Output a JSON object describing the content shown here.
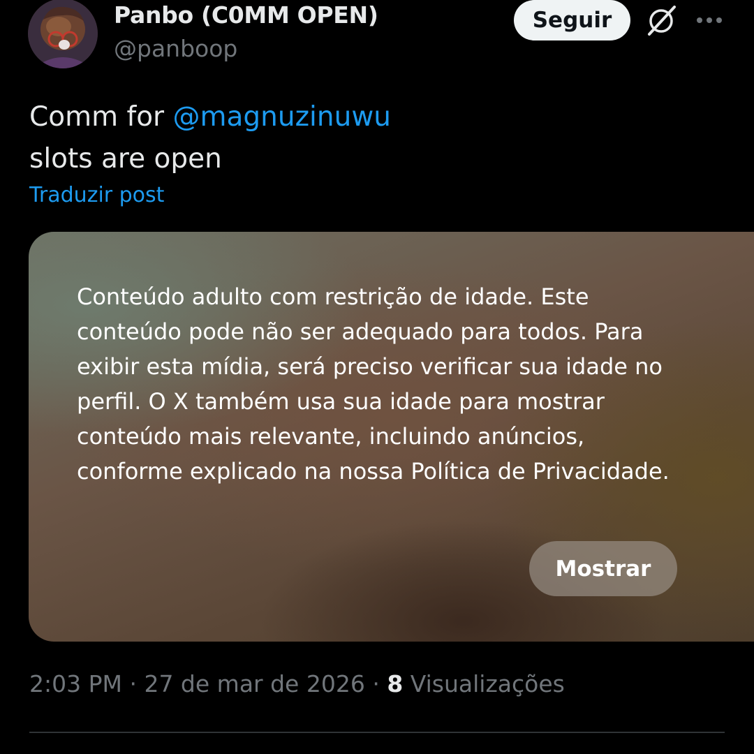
{
  "author": {
    "display_name": "Panbo (C0MM OPEN)",
    "handle": "@panboop"
  },
  "header": {
    "follow_label": "Seguir",
    "grok_icon": "grok-icon",
    "more_icon": "more-horizontal-icon"
  },
  "post": {
    "text_prefix": "Comm for ",
    "mention": "@magnuzinuwu",
    "text_line2": "slots are open",
    "translate_label": "Traduzir post"
  },
  "media": {
    "warning": "Conteúdo adulto com restrição de idade. Este conteúdo pode não ser adequado para todos. Para exibir esta mídia, será preciso verificar sua idade no perfil. O X também usa sua idade para mostrar conteúdo mais relevante, incluindo anúncios, conforme explicado na nossa Política de Privacidade.",
    "show_label": "Mostrar"
  },
  "meta": {
    "time": "2:03 PM",
    "separator": " · ",
    "date": "27 de mar de 2026",
    "views_count": "8",
    "views_label": " Visualizações"
  },
  "colors": {
    "link": "#1d9bf0",
    "text": "#e7e9ea",
    "secondary": "#71767b",
    "background": "#000000"
  }
}
